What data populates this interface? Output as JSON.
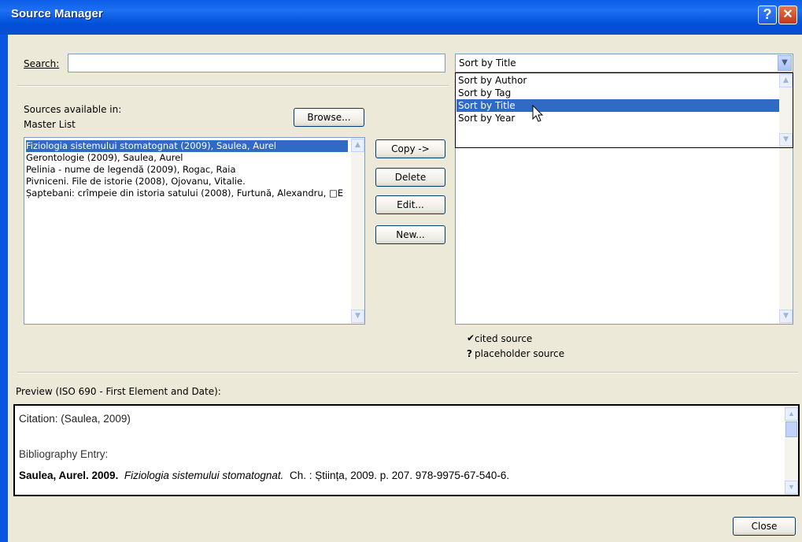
{
  "window": {
    "title": "Source Manager"
  },
  "search": {
    "label": "Search:",
    "value": ""
  },
  "sort": {
    "selected": "Sort by Title",
    "options": [
      "Sort by Author",
      "Sort by Tag",
      "Sort by Title",
      "Sort by Year"
    ]
  },
  "sources": {
    "label": "Sources available in:",
    "list_name": "Master List",
    "browse_label": "Browse...",
    "items": [
      "Fiziologia sistemului stomatognat (2009), Saulea, Aurel",
      "Gerontologie (2009), Saulea, Aurel",
      "Pelinia - nume de legendă (2009), Rogac, Raia",
      "Pivniceni. File de istorie (2008), Ojovanu, Vitalie.",
      "Șaptebani: crîmpeie din istoria satului (2008), Furtună, Alexandru, □E"
    ]
  },
  "actions": {
    "copy": "Copy ->",
    "delete": "Delete",
    "edit": "Edit...",
    "new": "New..."
  },
  "legend": {
    "cited_symbol": "✔",
    "cited": "cited source",
    "placeholder_symbol": "?",
    "placeholder": "placeholder source"
  },
  "preview": {
    "label": "Preview (ISO 690 - First Element and Date):",
    "citation": "Citation: (Saulea, 2009)",
    "bib_label": "Bibliography Entry:",
    "bib_author": "Saulea, Aurel. 2009.",
    "bib_title": "Fiziologia sistemului stomatognat.",
    "bib_rest": "Ch. : Știința, 2009. p. 207. 978-9975-67-540-6."
  },
  "footer": {
    "close_label": "Close"
  },
  "colors": {
    "titlebar": "#0a5ee8",
    "selection": "#316ac5",
    "dialog": "#ece9d8"
  }
}
